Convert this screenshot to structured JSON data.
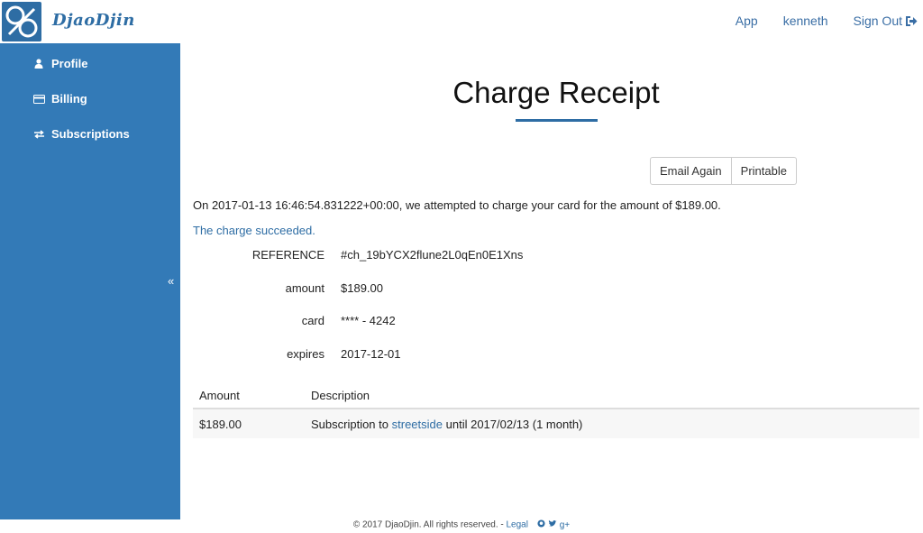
{
  "header": {
    "brand": "DjaoDjin",
    "nav": {
      "app": "App",
      "user": "kenneth",
      "sign_out": "Sign Out"
    }
  },
  "sidebar": {
    "items": [
      {
        "label": "Profile",
        "icon": "user-icon"
      },
      {
        "label": "Billing",
        "icon": "credit-card-icon"
      },
      {
        "label": "Subscriptions",
        "icon": "exchange-icon"
      }
    ],
    "collapse_glyph": "«"
  },
  "main": {
    "title": "Charge Receipt",
    "buttons": {
      "email_again": "Email Again",
      "printable": "Printable"
    },
    "attempt_message": "On 2017-01-13 16:46:54.831222+00:00, we attempted to charge your card for the amount of $189.00.",
    "result_message": "The charge succeeded.",
    "details": [
      {
        "label": "REFERENCE",
        "value": "#ch_19bYCX2flune2L0qEn0E1Xns"
      },
      {
        "label": "amount",
        "value": "$189.00"
      },
      {
        "label": "card",
        "value": "**** - 4242"
      },
      {
        "label": "expires",
        "value": "2017-12-01"
      }
    ],
    "table": {
      "headers": {
        "amount": "Amount",
        "description": "Description"
      },
      "rows": [
        {
          "amount": "$189.00",
          "desc_prefix": "Subscription to",
          "desc_link": "streetside",
          "desc_suffix": "until 2017/02/13 (1 month)"
        }
      ]
    }
  },
  "footer": {
    "copyright": "© 2017 DjaoDjin. All rights reserved. -",
    "legal": "Legal",
    "social_icons": [
      "github-icon",
      "twitter-icon",
      "google-plus-icon"
    ],
    "google_plus_glyph": "g+"
  },
  "colors": {
    "brand": "#2e6da4",
    "sidebar": "#337ab7"
  }
}
